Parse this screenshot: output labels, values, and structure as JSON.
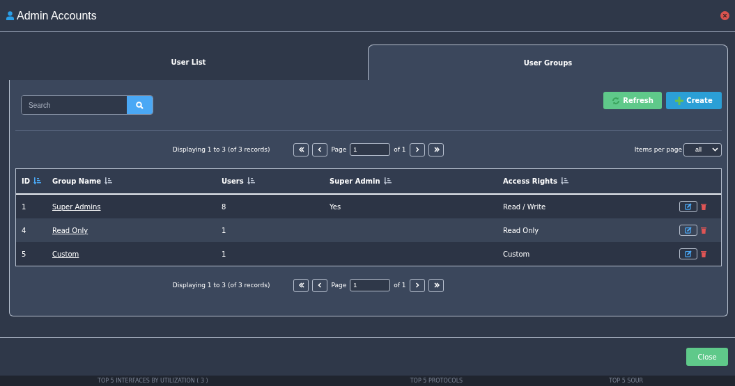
{
  "window": {
    "title": "Admin Accounts"
  },
  "tabs": [
    {
      "label": "User List",
      "selected": false
    },
    {
      "label": "User Groups",
      "selected": true
    }
  ],
  "search": {
    "placeholder": "Search"
  },
  "buttons": {
    "refresh": "Refresh",
    "create": "Create"
  },
  "pagination_top": {
    "summary": "Displaying 1 to 3 (of 3 records)",
    "page_label": "Page",
    "page": "1",
    "of": "of 1",
    "items_label": "Items per page",
    "items_value": "all"
  },
  "table": {
    "columns": [
      {
        "label": "ID",
        "sorted": true
      },
      {
        "label": "Group Name",
        "sorted": false
      },
      {
        "label": "Users",
        "sorted": false
      },
      {
        "label": "Super Admin",
        "sorted": false
      },
      {
        "label": "Access Rights",
        "sorted": false
      }
    ],
    "rows": [
      {
        "id": "1",
        "name": "Super Admins",
        "users": "8",
        "super_admin": "Yes",
        "access": "Read / Write"
      },
      {
        "id": "4",
        "name": "Read Only",
        "users": "1",
        "access": "Read Only"
      },
      {
        "id": "5",
        "name": "Custom",
        "users": "1",
        "access": "Custom"
      }
    ]
  },
  "pagination_bottom": {
    "summary": "Displaying 1 to 3 (of 3 records)",
    "page_label": "Page",
    "page": "1",
    "of": "of 1"
  },
  "footer": {
    "close": "Close"
  },
  "background_widgets": [
    "TOP 5 INTERFACES BY UTILIZATION ( 3 )",
    "TOP 5 PROTOCOLS",
    "TOP 5 SOUR"
  ]
}
